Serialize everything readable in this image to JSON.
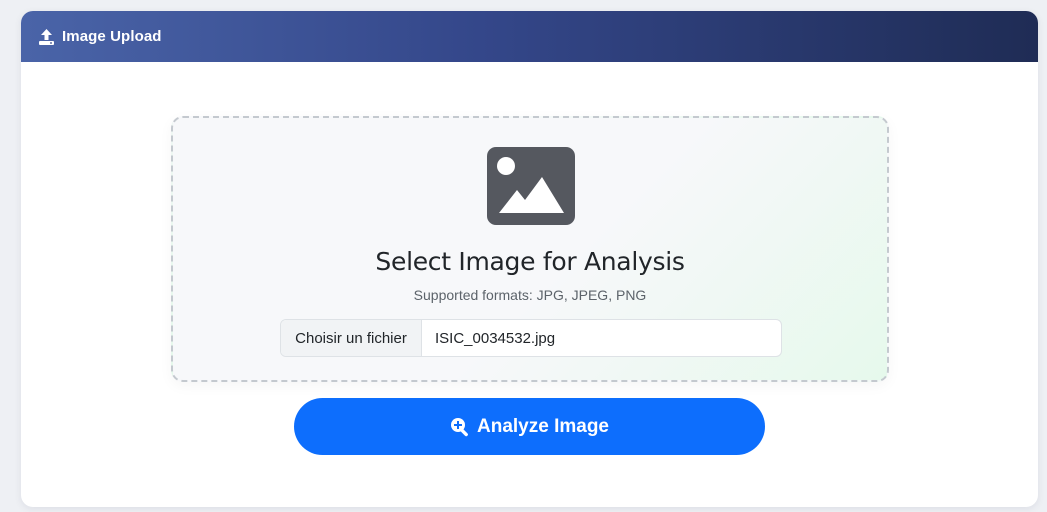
{
  "header": {
    "title": "Image Upload",
    "icon": "upload-icon"
  },
  "upload": {
    "icon": "image-icon",
    "title": "Select Image for Analysis",
    "subtitle": "Supported formats: JPG, JPEG, PNG",
    "choose_file_label": "Choisir un fichier",
    "file_name": "ISIC_0034532.jpg"
  },
  "action": {
    "analyze_label": "Analyze Image",
    "icon": "search-plus-icon"
  },
  "colors": {
    "header_start": "#4a64a8",
    "header_end": "#1f2c55",
    "primary": "#0d6efd"
  }
}
